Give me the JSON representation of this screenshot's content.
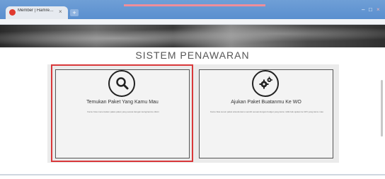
{
  "browser": {
    "tab_title": "Member | Hamreo Sistem...",
    "tab_close": "×",
    "new_tab": "+",
    "window_controls": [
      "–",
      "□",
      "×"
    ],
    "accent": "#5a8fcf"
  },
  "page": {
    "heading": "SISTEM PENAWARAN",
    "cards": [
      {
        "title": "Temukan Paket Yang Kamu Mau",
        "description": "Kamu bisa menemukan paket-paket yang sesuai dengan keinginanmu disini",
        "icon": "search-icon"
      },
      {
        "title": "Ajukan Paket Buatanmu Ke WO",
        "description": "Kamu bisa susun paket wisuda kamu sendiri sesuai dengan budget yang kamu miliki lalu ajukan ke WO yang kamu mau",
        "icon": "gears-icon"
      }
    ],
    "highlight_color": "#d9383a"
  }
}
